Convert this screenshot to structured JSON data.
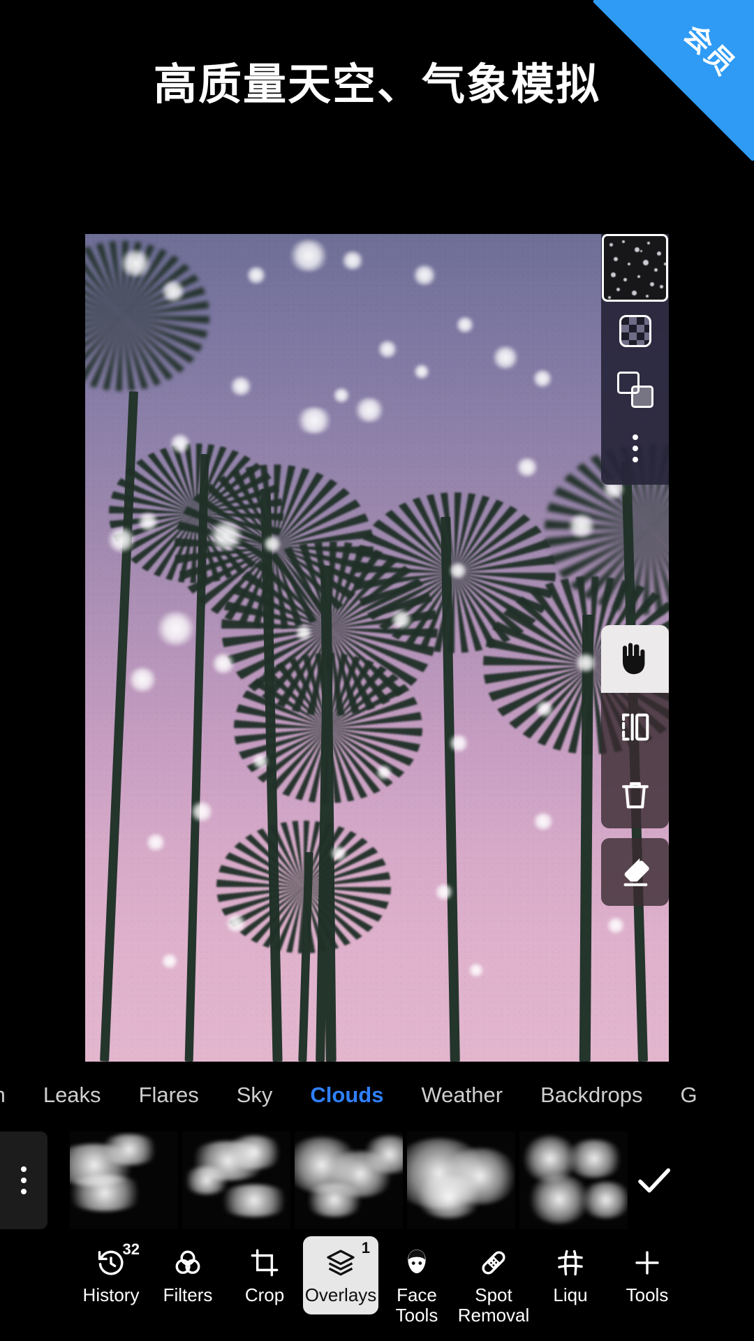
{
  "ribbon": {
    "label": "会员"
  },
  "headline": {
    "text": "高质量天空、气象模拟"
  },
  "colors": {
    "ribbon_blue": "#2f9bf5",
    "active_tab_blue": "#2f80ff",
    "selected_tool_bg": "#e7e7e7",
    "panel_bg": "#28263a",
    "sky_top": "#6e6e96",
    "sky_bottom": "#e3b6ce"
  },
  "layer_panel": {
    "thumbnail_name": "overlay-layer-thumbnail",
    "buttons": [
      {
        "name": "mask-checkerboard-button",
        "icon": "checkerboard-icon"
      },
      {
        "name": "blend-mode-button",
        "icon": "overlapping-squares-icon"
      },
      {
        "name": "layer-more-button",
        "icon": "more-vertical-icon"
      }
    ]
  },
  "tool_cluster": {
    "buttons": [
      {
        "name": "pan-tool-button",
        "icon": "hand-icon",
        "active": true
      },
      {
        "name": "flip-tool-button",
        "icon": "flip-horizontal-icon",
        "active": false
      },
      {
        "name": "delete-layer-button",
        "icon": "trash-icon",
        "active": false
      },
      {
        "name": "eraser-tool-button",
        "icon": "eraser-icon",
        "active": false
      }
    ]
  },
  "tabs": {
    "items": [
      {
        "label": "m",
        "active": false,
        "clipped": true
      },
      {
        "label": "Leaks",
        "active": false
      },
      {
        "label": "Flares",
        "active": false
      },
      {
        "label": "Sky",
        "active": false
      },
      {
        "label": "Clouds",
        "active": true
      },
      {
        "label": "Weather",
        "active": false
      },
      {
        "label": "Backdrops",
        "active": false
      },
      {
        "label": "G",
        "active": false,
        "clipped": true
      }
    ]
  },
  "thumbrow": {
    "more_icon": "more-vertical-icon",
    "confirm_icon": "checkmark-icon",
    "items": [
      {
        "name": "cloud-thumbnail-1"
      },
      {
        "name": "cloud-thumbnail-2"
      },
      {
        "name": "cloud-thumbnail-3"
      },
      {
        "name": "cloud-thumbnail-4"
      },
      {
        "name": "cloud-thumbnail-5"
      }
    ]
  },
  "toolbar": {
    "items": [
      {
        "label": "History",
        "icon": "history-undo-icon",
        "badge": "32",
        "selected": false
      },
      {
        "label": "Filters",
        "icon": "filters-circles-icon",
        "badge": "",
        "selected": false
      },
      {
        "label": "Crop",
        "icon": "crop-icon",
        "badge": "",
        "selected": false
      },
      {
        "label": "Overlays",
        "icon": "layers-icon",
        "badge": "1",
        "selected": true
      },
      {
        "label": "Face\nTools",
        "icon": "face-icon",
        "badge": "",
        "selected": false
      },
      {
        "label": "Spot\nRemoval",
        "icon": "bandage-icon",
        "badge": "",
        "selected": false
      },
      {
        "label": "Liqu",
        "icon": "liquify-grid-icon",
        "badge": "",
        "selected": false
      },
      {
        "label": "Tools",
        "icon": "plus-icon",
        "badge": "",
        "selected": false
      }
    ]
  }
}
